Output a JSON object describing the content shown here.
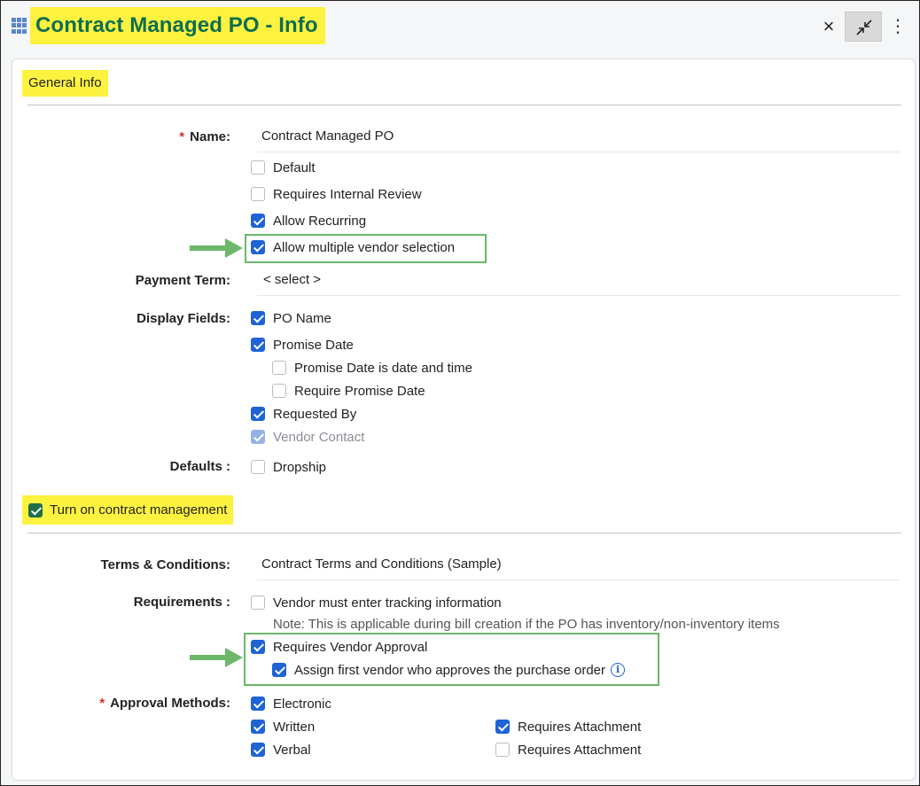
{
  "header": {
    "title": "Contract Managed PO - Info",
    "close_glyph": "×",
    "kebab_glyph": "⋮"
  },
  "general_info": {
    "section_label": "General Info",
    "name_label": "Name:",
    "name_required": "*",
    "name_value": "Contract Managed PO",
    "flags": [
      {
        "label": "Default",
        "checked": false
      },
      {
        "label": "Requires Internal Review",
        "checked": false
      },
      {
        "label": "Allow Recurring",
        "checked": true
      },
      {
        "label": "Allow multiple vendor selection",
        "checked": true
      }
    ],
    "payment_term_label": "Payment Term:",
    "payment_term_value": "< select >",
    "display_fields_label": "Display Fields:",
    "display_fields": [
      {
        "label": "PO Name",
        "checked": true
      },
      {
        "label": "Promise Date",
        "checked": true
      },
      {
        "label": "Promise Date is date and time",
        "checked": false
      },
      {
        "label": "Require Promise Date",
        "checked": false
      },
      {
        "label": "Requested By",
        "checked": true
      },
      {
        "label": "Vendor Contact",
        "checked": true
      }
    ],
    "defaults_label": "Defaults :",
    "defaults": [
      {
        "label": "Dropship",
        "checked": false
      }
    ]
  },
  "contract": {
    "toggle_label": "Turn on contract management",
    "toggle_checked": true,
    "terms_label": "Terms & Conditions:",
    "terms_value": "Contract Terms and Conditions (Sample)",
    "requirements_label": "Requirements :",
    "requirements": [
      {
        "label": "Vendor must enter tracking information",
        "checked": false
      },
      {
        "label": "Requires Vendor Approval",
        "checked": true
      },
      {
        "label": "Assign first vendor who approves the purchase order",
        "checked": true
      }
    ],
    "requirements_note": "Note: This is applicable during bill creation if the PO has inventory/non-inventory items",
    "approval_label": "Approval Methods:",
    "approval_required": "*",
    "approval_methods": [
      {
        "label": "Electronic",
        "checked": true
      },
      {
        "label": "Written",
        "checked": true
      },
      {
        "label": "Verbal",
        "checked": true
      }
    ],
    "attachments": [
      {
        "label": "Requires Attachment",
        "checked": true
      },
      {
        "label": "Requires Attachment",
        "checked": false
      }
    ]
  },
  "icons": {
    "app": "grid-icon",
    "close": "close-icon",
    "collapse": "collapse-icon",
    "menu": "kebab-menu-icon",
    "info": "info-icon",
    "arrow": "arrow-right-icon"
  },
  "colors": {
    "highlight": "#fdf23f",
    "title_text": "#0f6e4f",
    "checkbox_on": "#1f63d4",
    "callout_border": "#6cb76a",
    "required": "#d92c2c"
  }
}
